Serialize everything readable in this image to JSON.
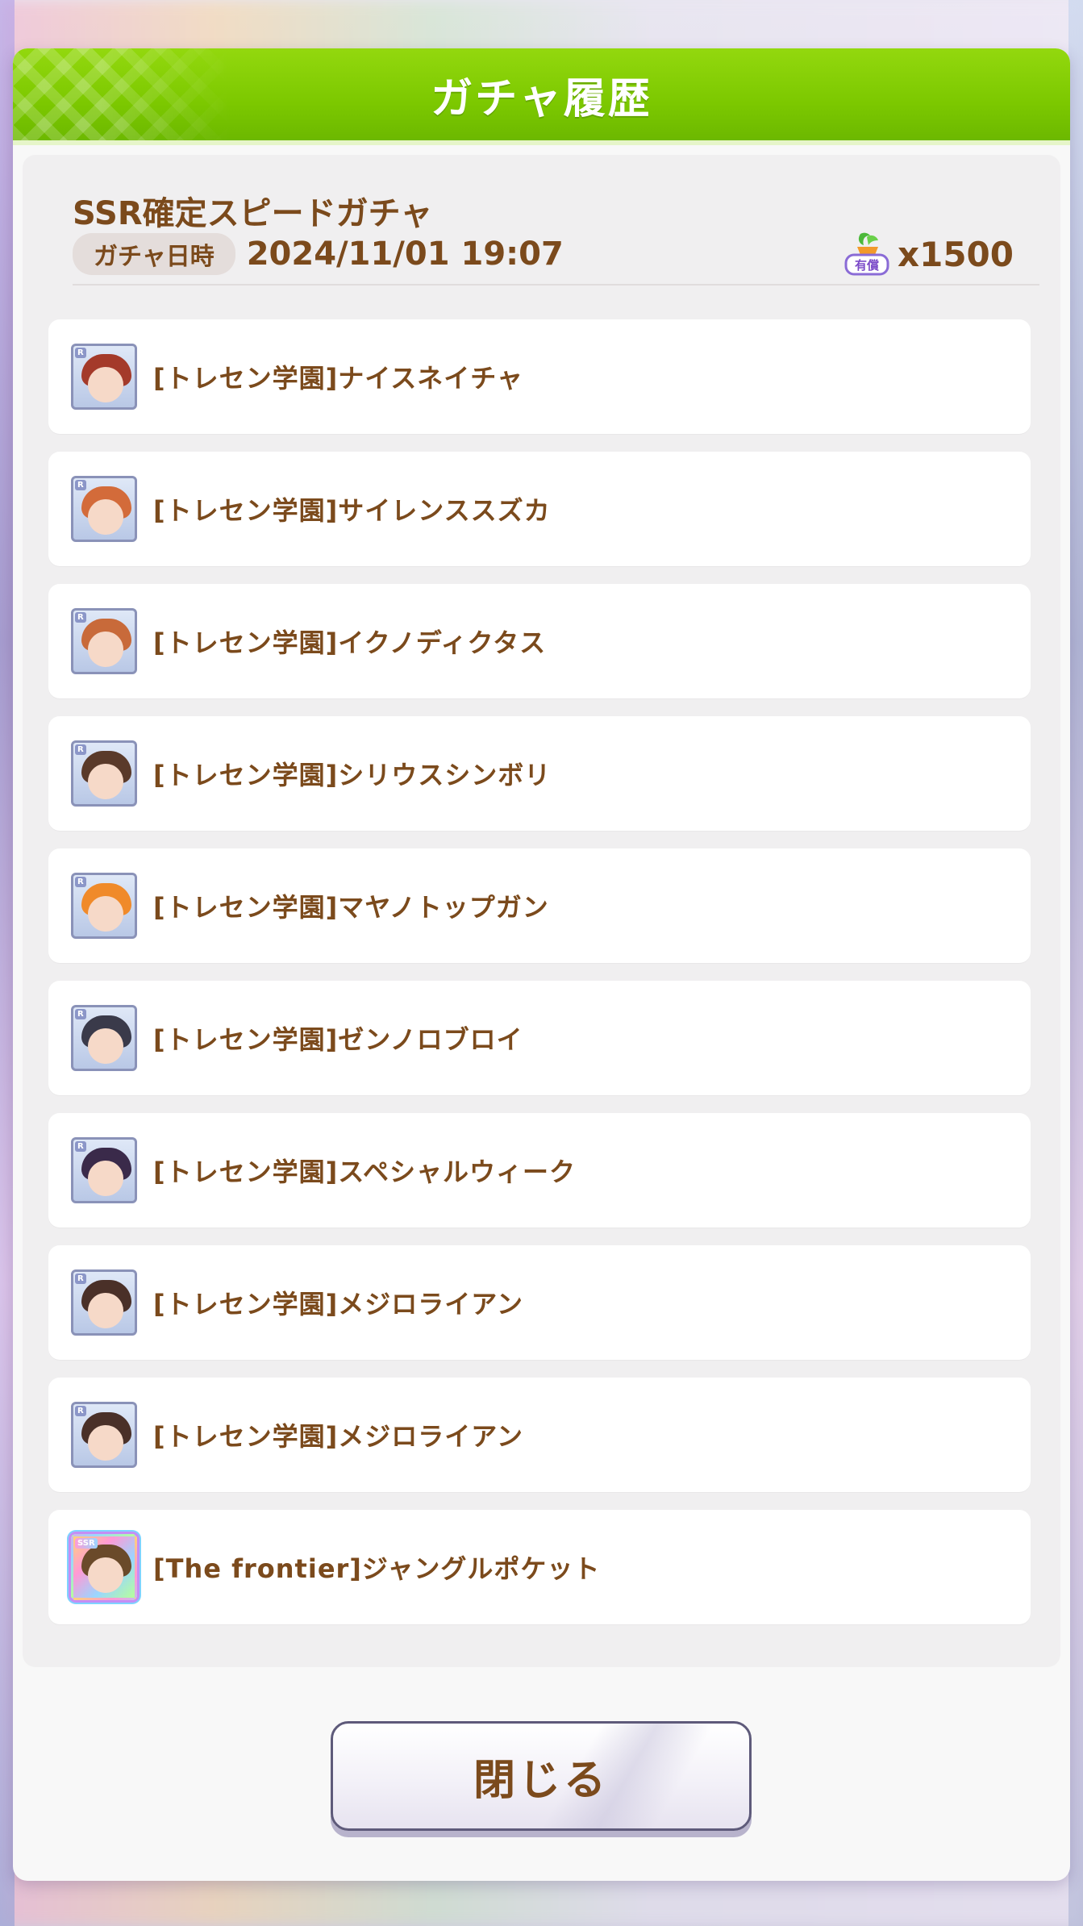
{
  "dialog": {
    "title": "ガチャ履歴",
    "header_color": "#7cc800"
  },
  "gacha": {
    "name": "SSR確定スピードガチャ",
    "date_label": "ガチャ日時",
    "date_value": "2024/11/01 19:07",
    "cost_badge_text": "有償",
    "cost_icon": "carrot-icon",
    "cost_value": "x1500"
  },
  "results": [
    {
      "rarity": "R",
      "name": "[トレセン学園]ナイスネイチャ",
      "hair_color": "#a43a2a"
    },
    {
      "rarity": "R",
      "name": "[トレセン学園]サイレンススズカ",
      "hair_color": "#d36b3a"
    },
    {
      "rarity": "R",
      "name": "[トレセン学園]イクノディクタス",
      "hair_color": "#c86a3a"
    },
    {
      "rarity": "R",
      "name": "[トレセン学園]シリウスシンボリ",
      "hair_color": "#5a3a2a"
    },
    {
      "rarity": "R",
      "name": "[トレセン学園]マヤノトップガン",
      "hair_color": "#f08a2a"
    },
    {
      "rarity": "R",
      "name": "[トレセン学園]ゼンノロブロイ",
      "hair_color": "#3a3a4a"
    },
    {
      "rarity": "R",
      "name": "[トレセン学園]スペシャルウィーク",
      "hair_color": "#3a2a4a"
    },
    {
      "rarity": "R",
      "name": "[トレセン学園]メジロライアン",
      "hair_color": "#4a3028"
    },
    {
      "rarity": "R",
      "name": "[トレセン学園]メジロライアン",
      "hair_color": "#4a3028"
    },
    {
      "rarity": "SSR",
      "name": "[The frontier]ジャングルポケット",
      "hair_color": "#6a4a2a"
    }
  ],
  "footer": {
    "close_label": "閉じる"
  },
  "colors": {
    "text_brown": "#7b4a1c",
    "panel_bg": "#f0eff0"
  }
}
